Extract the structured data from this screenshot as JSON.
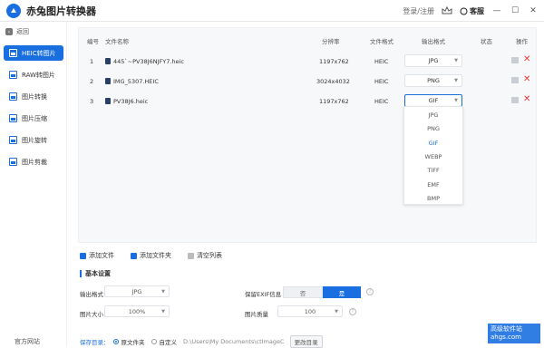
{
  "app": {
    "title": "赤兔图片转换器",
    "login": "登录/注册",
    "service": "客服",
    "win_min": "—",
    "win_max": "☐",
    "win_close": "✕",
    "brand_color": "#1a6fe0"
  },
  "sidebar": {
    "back": "返回",
    "items": [
      {
        "label": "HEIC转图片",
        "active": true
      },
      {
        "label": "RAW转图片",
        "active": false
      },
      {
        "label": "图片转换",
        "active": false
      },
      {
        "label": "图片压缩",
        "active": false
      },
      {
        "label": "图片旋转",
        "active": false
      },
      {
        "label": "图片剪裁",
        "active": false
      }
    ],
    "official": "官方网站"
  },
  "table": {
    "headers": {
      "num": "编号",
      "name": "文件名称",
      "resolution": "分辨率",
      "format": "文件格式",
      "output": "输出格式",
      "status": "状态",
      "action": "操作"
    },
    "rows": [
      {
        "num": "1",
        "name": "445`~PV38J6NJFY7.heic",
        "resolution": "1197x762",
        "format": "HEIC",
        "output": "JPG",
        "status": ""
      },
      {
        "num": "2",
        "name": "IMG_5307.HEIC",
        "resolution": "3024x4032",
        "format": "HEIC",
        "output": "PNG",
        "status": ""
      },
      {
        "num": "3",
        "name": "PV38J6.heic",
        "resolution": "1197x762",
        "format": "HEIC",
        "output": "GIF",
        "status": ""
      }
    ],
    "dropdown_options": [
      "JPG",
      "PNG",
      "GIF",
      "WEBP",
      "TIFF",
      "EMF",
      "BMP"
    ],
    "dropdown_selected": "GIF"
  },
  "actions": {
    "add_file": "添加文件",
    "add_folder": "添加文件夹",
    "clear_list": "清空列表"
  },
  "settings": {
    "title": "基本设置",
    "output_format_label": "输出格式",
    "output_format_value": "JPG",
    "keep_exif_label": "保留EXIF信息",
    "exif_no": "否",
    "exif_yes": "是",
    "image_size_label": "图片大小",
    "image_size_value": "100%",
    "image_quality_label": "图片质量",
    "image_quality_value": "100"
  },
  "save": {
    "label": "保存目录：",
    "opt1": "原文件夹",
    "opt2": "自定义",
    "path": "D:\\Users\\My Documents\\ctImageC",
    "change": "更改目录"
  },
  "watermark": {
    "line1": "高级软件站",
    "line2": "ahgs.com"
  }
}
